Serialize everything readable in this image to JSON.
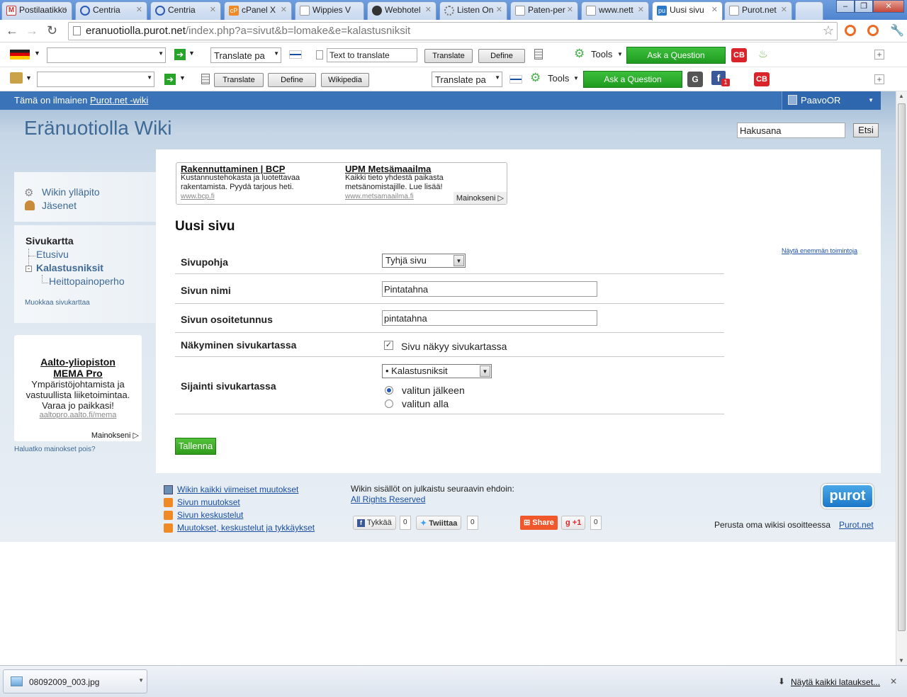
{
  "browser": {
    "tabs": [
      {
        "label": "Postilaatikko"
      },
      {
        "label": "Centria"
      },
      {
        "label": "Centria"
      },
      {
        "label": "cPanel X"
      },
      {
        "label": "Wippies V"
      },
      {
        "label": "Webhotel"
      },
      {
        "label": "Listen On"
      },
      {
        "label": "Paten-per"
      },
      {
        "label": "www.nett"
      },
      {
        "label": "Uusi sivu"
      },
      {
        "label": "Purot.net"
      }
    ],
    "url_host": "eranuotiolla.purot.net",
    "url_path": "/index.php?a=sivut&b=lomake&e=kalastusniksit"
  },
  "toolbar1": {
    "translate_select": "Translate pa",
    "text_field": "Text to translate",
    "translate_label": "Translate",
    "define_label": "Define",
    "tools_label": "Tools",
    "ask_label": "Ask a Question",
    "cb_label": "CB"
  },
  "toolbar2": {
    "translate_label": "Translate",
    "define_label": "Define",
    "wikipedia_label": "Wikipedia",
    "translate_select": "Translate pa",
    "tools_label": "Tools",
    "ask_label": "Ask a Question",
    "g_label": "G",
    "fb_badge": "1",
    "cb_label": "CB"
  },
  "site": {
    "topbar_text": "Tämä on ilmainen",
    "topbar_link": "Purot.net -wiki",
    "user": "PaavoOR",
    "title": "Eränuotiolla Wiki",
    "search_value": "Hakusana",
    "search_button": "Etsi"
  },
  "sidebar": {
    "admin_link": "Wikin ylläpito",
    "members_link": "Jäsenet",
    "sitemap_title": "Sivukartta",
    "sitemap_items": [
      "Etusivu",
      "Kalastusniksit",
      "Heittopainoperho"
    ],
    "edit_sitemap": "Muokkaa sivukarttaa",
    "ad_title_1": "Aalto-yliopiston",
    "ad_title_2": "MEMA Pro",
    "ad_body_1": "Ympäristöjohtamista ja",
    "ad_body_2": "vastuullista liiketoimintaa.",
    "ad_body_3": "Varaa jo paikkasi!",
    "ad_url": "aaltopro.aalto.fi/mema",
    "ad_label": "Mainokseni",
    "remove_ads": "Haluatko mainokset pois?"
  },
  "ads": {
    "ad1_title": "Rakennuttaminen | BCP",
    "ad1_line1": "Kustannustehokasta ja luotettavaa",
    "ad1_line2": "rakentamista. Pyydä tarjous heti.",
    "ad1_url": "www.bcp.fi",
    "ad2_title": "UPM Metsämaailma",
    "ad2_line1": "Kaikki tieto yhdestä paikasta",
    "ad2_line2": "metsänomistajille. Lue lisää!",
    "ad2_url": "www.metsamaailma.fi",
    "label": "Mainokseni"
  },
  "form": {
    "page_heading": "Uusi sivu",
    "more_actions": "Näytä enemmän toimintoja",
    "template_label": "Sivupohja",
    "template_value": "Tyhjä sivu",
    "name_label": "Sivun nimi",
    "name_value": "Pintatahna",
    "slug_label": "Sivun osoitetunnus",
    "slug_value": "pintatahna",
    "visibility_label": "Näkyminen sivukartassa",
    "visibility_checkbox": "Sivu näkyy sivukartassa",
    "visibility_checked": true,
    "location_label": "Sijainti sivukartassa",
    "location_value": "• Kalastusniksit",
    "radio_after": "valitun jälkeen",
    "radio_under": "valitun alla",
    "selected_radio": "valitun jälkeen",
    "save_button": "Tallenna"
  },
  "footer": {
    "links": [
      "Wikin kaikki viimeiset muutokset",
      "Sivun muutokset",
      "Sivun keskustelut",
      "Muutokset, keskustelut ja tykkäykset"
    ],
    "license_text": "Wikin sisällöt on julkaistu seuraavin ehdoin:",
    "license_link": "All Rights Reserved",
    "like_label": "Tykkää",
    "like_count": "0",
    "tweet_label": "Twiittaa",
    "tweet_count": "0",
    "share_label": "Share",
    "plusone_label": "+1",
    "plusone_count": "0",
    "logo_text": "purot",
    "promo_text": "Perusta oma wikisi osoitteessa",
    "promo_link": "Purot.net"
  },
  "downloads": {
    "file": "08092009_003.jpg",
    "show_all": "Näytä kaikki lataukset..."
  }
}
